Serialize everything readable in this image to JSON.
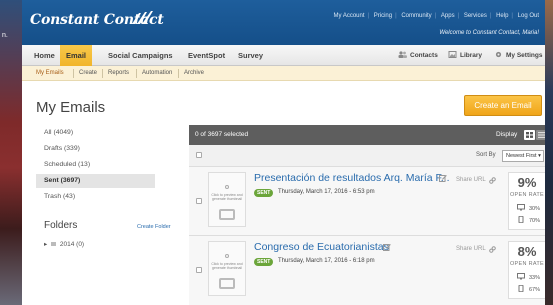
{
  "left_fragment": "n.",
  "header": {
    "logo": "Constant Contact",
    "top_links": [
      "My Account",
      "Pricing",
      "Community",
      "Apps",
      "Services",
      "Help",
      "Log Out"
    ],
    "welcome": "Welcome to Constant Contact, Maria!"
  },
  "main_nav": {
    "tabs": [
      "Home",
      "Email",
      "Social Campaigns",
      "EventSpot",
      "Survey"
    ],
    "active": "Email",
    "right": [
      "Contacts",
      "Library",
      "My Settings"
    ]
  },
  "sub_nav": {
    "items": [
      "My Emails",
      "Create",
      "Reports",
      "Automation",
      "Archive"
    ],
    "active": "My Emails"
  },
  "page": {
    "title": "My Emails",
    "create_button": "Create an Email"
  },
  "folders_list": [
    "All (4049)",
    "Drafts (339)",
    "Scheduled (13)",
    "Sent (3697)",
    "Trash (43)"
  ],
  "folders_active": "Sent (3697)",
  "folders": {
    "title": "Folders",
    "create": "Create Folder",
    "items": [
      "2014 (0)"
    ]
  },
  "list": {
    "selected": "0 of 3697 selected",
    "display_label": "Display",
    "sort_label": "Sort By",
    "sort_value": "Newest First"
  },
  "thumb_text": "Click to preview and generate thumbnail",
  "emails": [
    {
      "subject": "Presentación de resultados Arq. María F...",
      "status": "SENT",
      "date": "Thursday, March 17, 2016 - 6:53 pm",
      "share": "Share URL",
      "open_rate": "9%",
      "open_rate_label": "OPEN RATE",
      "desktop": "30%",
      "mobile": "70%"
    },
    {
      "subject": "Congreso de Ecuatorianistas",
      "status": "SENT",
      "date": "Thursday, March 17, 2016 - 6:18 pm",
      "share": "Share URL",
      "open_rate": "8%",
      "open_rate_label": "OPEN RATE",
      "desktop": "33%",
      "mobile": "67%"
    }
  ],
  "colors": {
    "header_blue": "#1e5e9c",
    "accent_orange": "#f1b52b",
    "link_blue": "#2a6cad",
    "sent_green": "#6ba53a"
  }
}
